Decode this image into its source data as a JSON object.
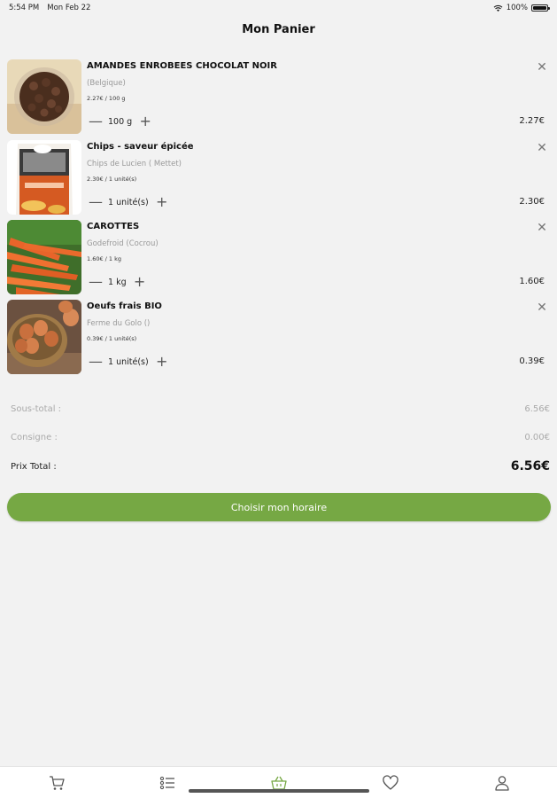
{
  "status_bar": {
    "time": "5:54 PM",
    "date": "Mon Feb 22",
    "battery": "100%",
    "battery_level": 1.0
  },
  "header": {
    "title": "Mon Panier"
  },
  "items": [
    {
      "name": "AMANDES ENROBEES CHOCOLAT NOIR",
      "origin": "(Belgique)",
      "unit_price": "2.27€ / 100 g",
      "quantity": "100 g",
      "price": "2.27€"
    },
    {
      "name": "Chips - saveur épicée",
      "origin": "Chips de Lucien ( Mettet)",
      "unit_price": "2.30€ / 1 unité(s)",
      "quantity": "1 unité(s)",
      "price": "2.30€"
    },
    {
      "name": "CAROTTES",
      "origin": "Godefroid (Cocrou)",
      "unit_price": "1.60€ / 1 kg",
      "quantity": "1 kg",
      "price": "1.60€"
    },
    {
      "name": "Oeufs frais BIO",
      "origin": "Ferme du Golo ()",
      "unit_price": "0.39€ / 1 unité(s)",
      "quantity": "1 unité(s)",
      "price": "0.39€"
    }
  ],
  "summary": {
    "subtotal_label": "Sous-total :",
    "subtotal_value": "6.56€",
    "deposit_label": "Consigne :",
    "deposit_value": "0.00€",
    "total_label": "Prix Total :",
    "total_value": "6.56€"
  },
  "cta": {
    "label": "Choisir mon horaire"
  },
  "tab_bar": {
    "tabs": [
      {
        "icon": "cart-icon"
      },
      {
        "icon": "list-icon"
      },
      {
        "icon": "basket-icon",
        "active": true
      },
      {
        "icon": "heart-icon"
      },
      {
        "icon": "user-icon"
      }
    ]
  },
  "colors": {
    "accent": "#76a844",
    "background": "#f2f2f2"
  }
}
